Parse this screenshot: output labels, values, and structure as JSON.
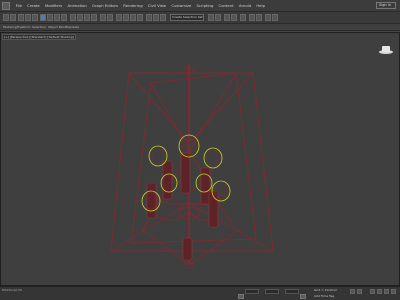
{
  "menubar": {
    "items": [
      "File",
      "Create",
      "Modifiers",
      "Animation",
      "Graph Editors",
      "Rendering",
      "Civil View",
      "Customize",
      "Scripting",
      "Content",
      "Arnold",
      "Help"
    ],
    "signin_label": "Sign In"
  },
  "toolbar": {
    "selection_set_placeholder": "Create Selection Set"
  },
  "ribbon": {
    "tabs": [
      "Modeling",
      "Freeform",
      "Selection",
      "Object Paint",
      "Populate"
    ]
  },
  "viewport": {
    "label": "[+] [Perspective] [Standard] [Default Shading]"
  },
  "statusbar": {
    "maxscript": "MAXScript Mi",
    "grid_text": "Grid = 10,0mm",
    "time_tag": "Add Time Tag"
  },
  "colors": {
    "wireframe": "#7a2c32",
    "gizmo": "#c8d62a",
    "viewport_bg": "#3f3f3f"
  }
}
